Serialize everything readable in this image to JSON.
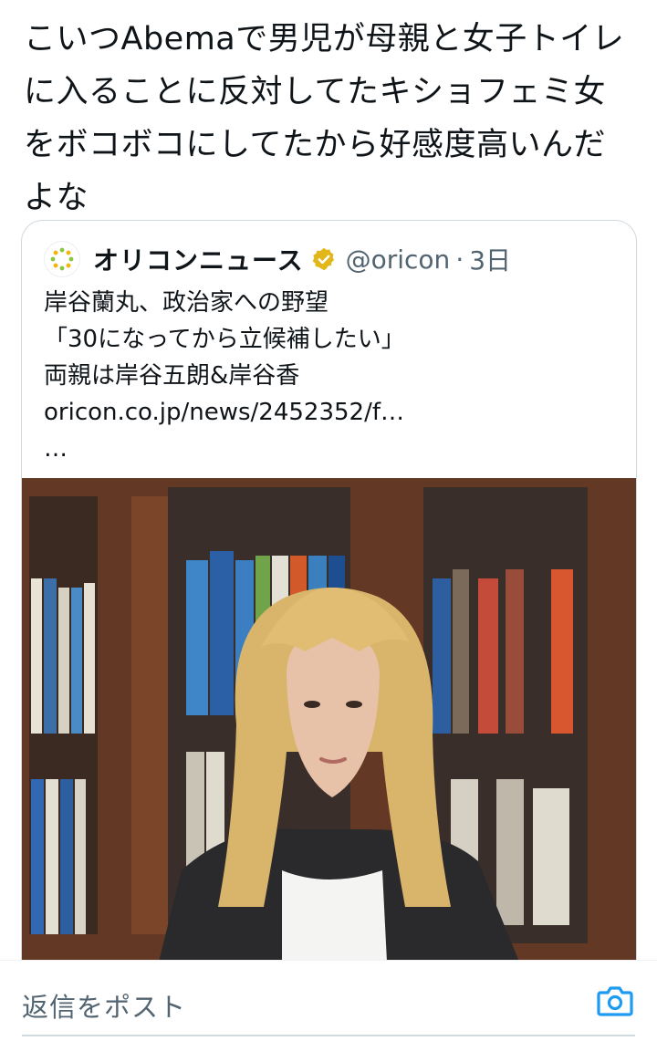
{
  "tweet": {
    "lines": [
      "こいつAbemaで男児が母親と女子トイレ",
      "に入ることに反対してたキショフェミ女",
      "をボコボコにしてたから好感度高いんだ",
      "よな"
    ]
  },
  "quote": {
    "account_name": "オリコンニュース",
    "handle": "@oricon",
    "separator": "·",
    "time": "3日",
    "lines": [
      "岸谷蘭丸、政治家への野望",
      "「30になってから立候補したい」",
      "両親は岸谷五朗&岸谷香",
      "oricon.co.jp/news/2452352/f…",
      "…"
    ],
    "verified_icon": "gold-check-badge",
    "colors": {
      "verified": "#e2b719",
      "border": "#cfd9de",
      "secondary": "#536471"
    }
  },
  "reply": {
    "placeholder": "返信をポスト",
    "camera_icon": "camera-icon",
    "accent": "#1d9bf0"
  }
}
